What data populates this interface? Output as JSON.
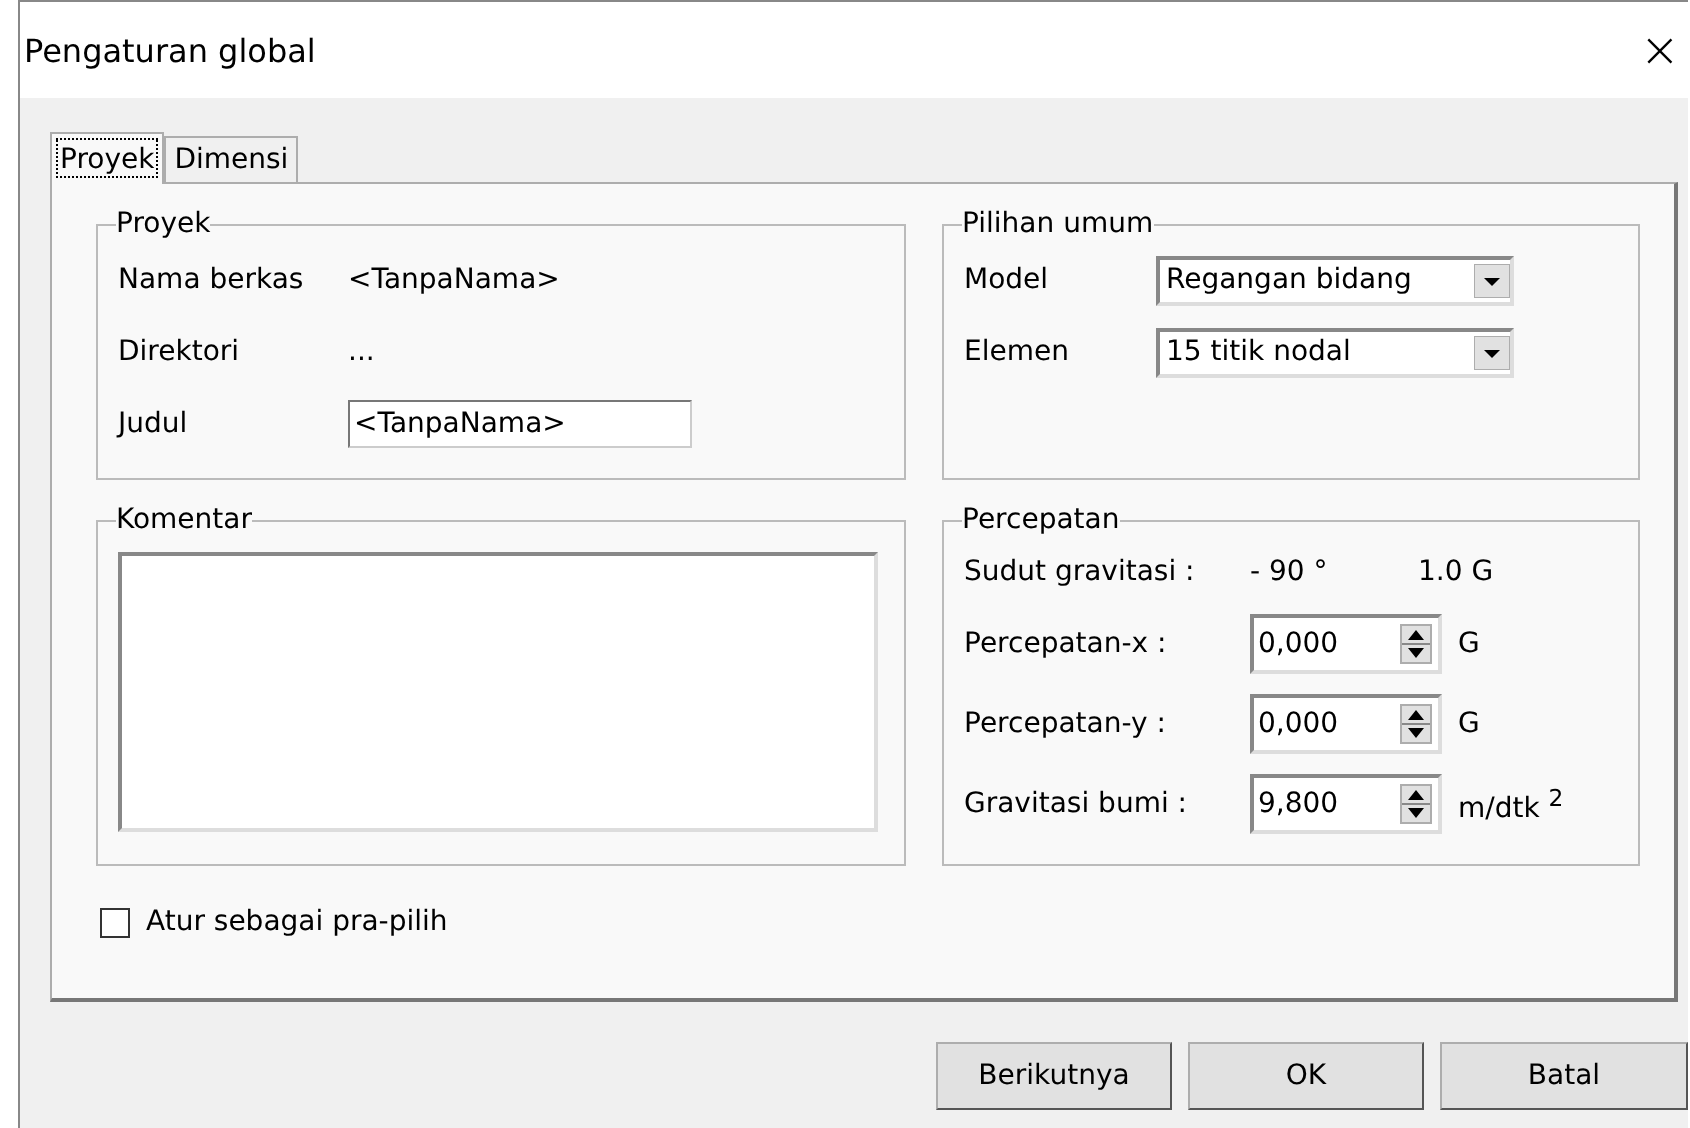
{
  "window": {
    "title": "Pengaturan global",
    "close": "×"
  },
  "tabs": [
    {
      "label": "Proyek",
      "selected": true
    },
    {
      "label": "Dimensi",
      "selected": false
    }
  ],
  "proyek": {
    "title": "Proyek",
    "rows": [
      {
        "kind": "text",
        "label": "Nama berkas",
        "value": "<TanpaNama>"
      },
      {
        "kind": "text",
        "label": "Direktori",
        "value": "..."
      },
      {
        "kind": "input",
        "label": "Judul",
        "value": "<TanpaNama>"
      }
    ]
  },
  "komentar": {
    "title": "Komentar"
  },
  "pilihan_umum": {
    "title": "Pilihan umum",
    "rows": [
      {
        "label": "Model",
        "value": "Regangan bidang"
      },
      {
        "label": "Elemen",
        "value": "15 titik nodal"
      }
    ]
  },
  "percepatan": {
    "title": "Percepatan",
    "gravity": {
      "label": "Sudut gravitasi :",
      "angle": "- 90 °",
      "magnitude": "1.0 G"
    },
    "rows": [
      {
        "label": "Percepatan-x :",
        "value": "0,000",
        "unit": "G"
      },
      {
        "label": "Percepatan-y :",
        "value": "0,000",
        "unit": "G"
      },
      {
        "label": "Gravitasi bumi :",
        "value": "9,800",
        "unit": "m/dtk $^{2}$"
      }
    ]
  },
  "default_checkbox": {
    "label": "Atur sebagai pra-pilih",
    "checked": false
  },
  "buttons": [
    {
      "label": "Berikutnya"
    },
    {
      "label": "OK"
    },
    {
      "label": "Batal"
    }
  ]
}
